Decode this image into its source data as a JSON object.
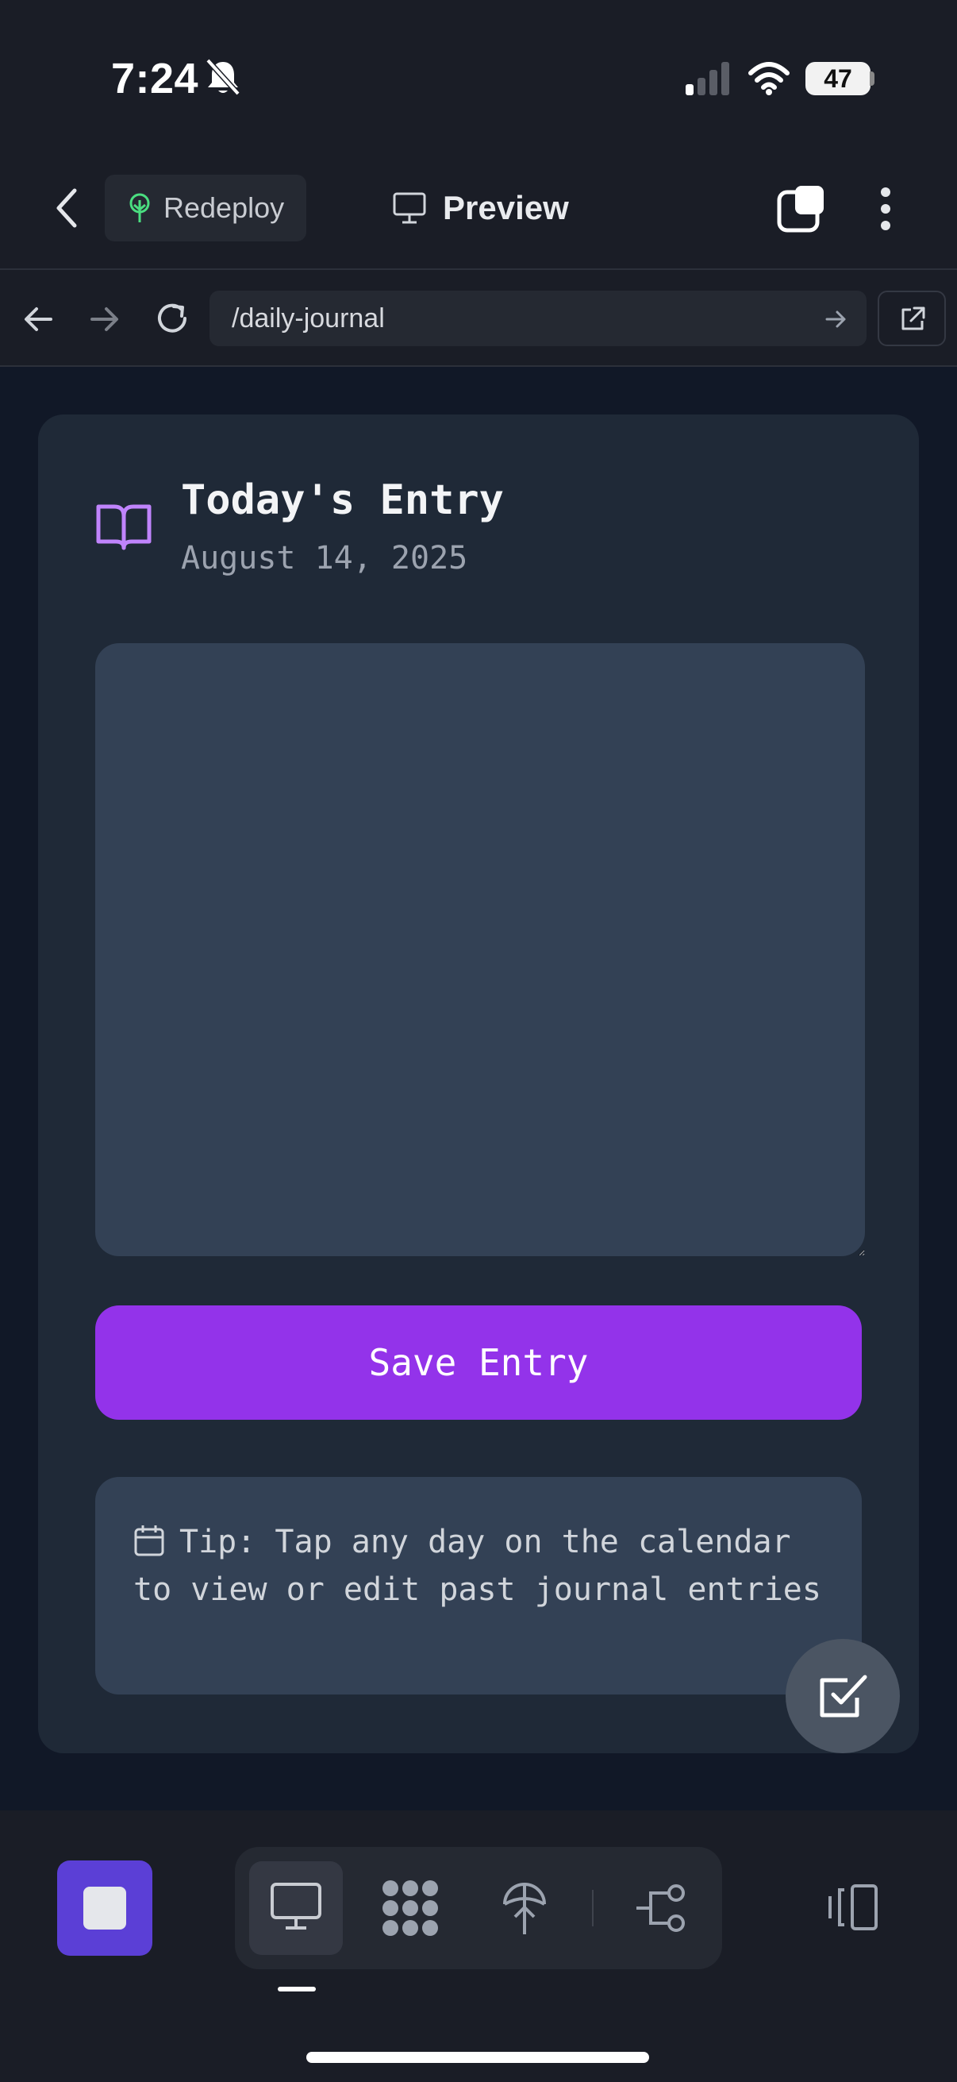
{
  "status_bar": {
    "time": "7:24",
    "battery": "47"
  },
  "header": {
    "redeploy_label": "Redeploy",
    "preview_label": "Preview"
  },
  "url_bar": {
    "path": "/daily-journal"
  },
  "journal": {
    "title": "Today's Entry",
    "date": "August 14, 2025",
    "entry_value": "",
    "save_label": "Save Entry",
    "tip": "Tip: Tap any day on the calendar to view or edit past journal entries"
  },
  "icons": {
    "status": [
      "bell-slash-icon",
      "signal-icon",
      "wifi-icon",
      "battery-icon"
    ],
    "header": [
      "back-chevron-icon",
      "tree-icon",
      "monitor-icon",
      "tabs-icon",
      "more-vertical-icon"
    ],
    "url_bar": [
      "arrow-left-icon",
      "arrow-right-icon",
      "reload-icon",
      "go-arrow-icon",
      "external-link-icon"
    ],
    "card": [
      "book-open-icon",
      "calendar-icon",
      "check-square-icon"
    ],
    "bottom_nav": [
      "stop-icon",
      "monitor-icon",
      "dots-grid-icon",
      "deploy-icon",
      "share-nodes-icon",
      "sidebar-panel-icon"
    ]
  },
  "colors": {
    "accent": "#9333ea",
    "stop_button": "#5b3fd6",
    "book_icon": "#c084fc",
    "card_bg": "#1f2937",
    "field_bg": "#334155"
  }
}
